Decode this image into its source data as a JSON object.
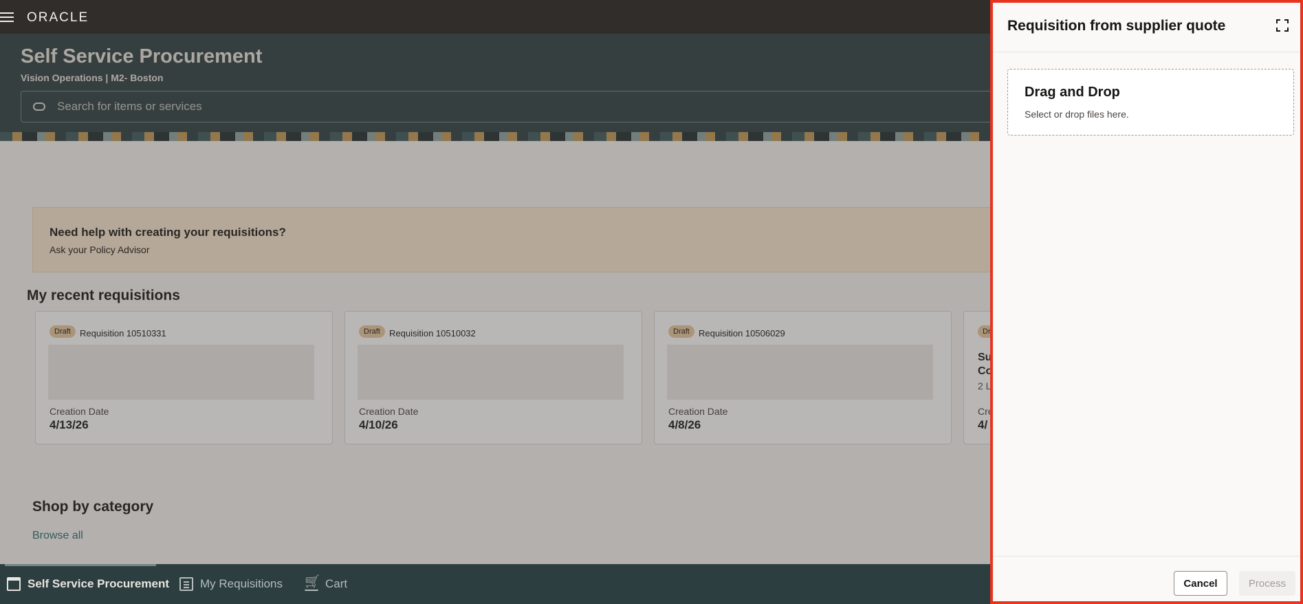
{
  "topbar": {
    "logo": "ORACLE"
  },
  "header": {
    "title": "Self Service Procurement",
    "subtitle": "Vision Operations | M2- Boston",
    "search_placeholder": "Search for items or services"
  },
  "help": {
    "title": "Need help with creating your requisitions?",
    "link": "Ask your Policy Advisor"
  },
  "recent": {
    "title": "My recent requisitions",
    "cards": [
      {
        "badge": "Draft",
        "title": "Requisition 10510331",
        "date_label": "Creation Date",
        "date": "4/13/26"
      },
      {
        "badge": "Draft",
        "title": "Requisition 10510032",
        "date_label": "Creation Date",
        "date": "4/10/26"
      },
      {
        "badge": "Draft",
        "title": "Requisition 10506029",
        "date_label": "Creation Date",
        "date": "4/8/26"
      }
    ],
    "partial_card": {
      "badge": "Dr",
      "line1": "Su",
      "line2": "Co",
      "line3": "2 L",
      "date_label": "Cre",
      "date": "4/"
    }
  },
  "shop": {
    "title": "Shop by category",
    "browse_all": "Browse all"
  },
  "bottom_nav": {
    "items": [
      {
        "label": "Self Service Procurement",
        "icon": "store-icon"
      },
      {
        "label": "My Requisitions",
        "icon": "clipboard-icon"
      },
      {
        "label": "Cart",
        "icon": "cart-icon"
      }
    ]
  },
  "drawer": {
    "title": "Requisition from supplier quote",
    "dropzone_title": "Drag and Drop",
    "dropzone_sub": "Select or drop files here.",
    "cancel": "Cancel",
    "process": "Process"
  }
}
